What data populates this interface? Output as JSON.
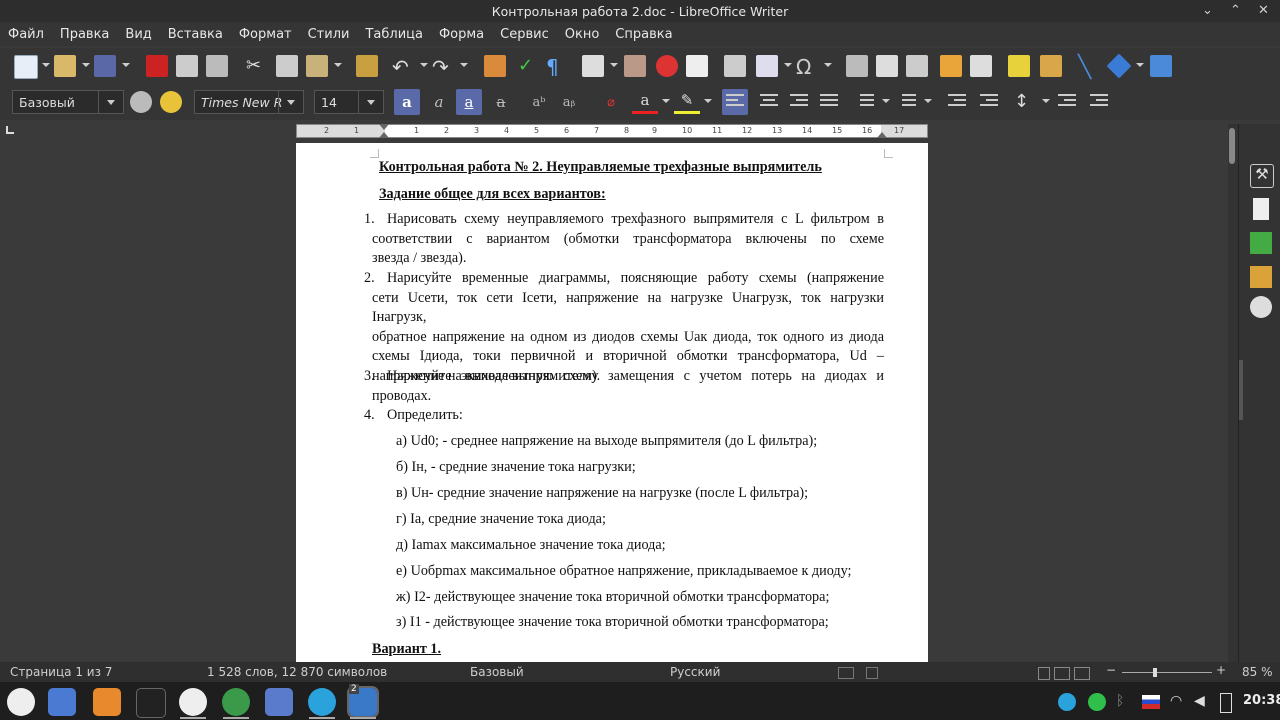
{
  "window": {
    "title": "Контрольная работа 2.doc - LibreOffice Writer"
  },
  "menu": {
    "items": [
      "Файл",
      "Правка",
      "Вид",
      "Вставка",
      "Формат",
      "Стили",
      "Таблица",
      "Форма",
      "Сервис",
      "Окно",
      "Справка"
    ]
  },
  "format_bar": {
    "paragraph_style": "Базовый",
    "font_name": "Times New R",
    "font_size": "14"
  },
  "ruler": {
    "ticks": [
      "2",
      "1",
      "1",
      "2",
      "3",
      "4",
      "5",
      "6",
      "7",
      "8",
      "9",
      "10",
      "11",
      "12",
      "13",
      "14",
      "15",
      "16",
      "17"
    ]
  },
  "document": {
    "title": "Контрольная работа № 2. Неуправляемые трехфазные выпрямитель",
    "subtitle": "Задание общее для всех вариантов:",
    "items": [
      {
        "num": "1.",
        "lines": [
          "Нарисовать схему неуправляемого трехфазного выпрямителя с L фильтром в",
          "соответствии с вариантом (обмотки трансформатора включены по схеме",
          "звезда / звезда)."
        ]
      },
      {
        "num": "2.",
        "lines": [
          "Нарисуйте временные диаграммы, поясняющие работу схемы (напряжение",
          "сети Uсети, ток сети Iсети, напряжение на нагрузке Uнагрузк, ток нагрузки Iнагрузк,",
          "обратное напряжение на одном из диодов схемы Uак диода, ток одного из диода",
          "схемы Iдиода, токи первичной и вторичной обмотки трансформатора, Ud –",
          "напряжение на выходе выпрямителя)."
        ]
      },
      {
        "num": "3.",
        "lines": [
          "Нарисуйте эквивалентную схему замещения с учетом потерь на диодах и",
          "проводах."
        ]
      },
      {
        "num": "4.",
        "lines": [
          "Определить:"
        ]
      }
    ],
    "subitems": [
      "а) Ud0; - среднее напряжение на выходе выпрямителя (до L фильтра);",
      "б) Iн, - средние значение тока нагрузки;",
      "в) Uн- средние значение напряжение на нагрузке (после L фильтра);",
      "г) Iа, средние значение тока диода;",
      "д) Iamax максимальное значение тока диода;",
      "е) Uобрmax максимальное обратное напряжение, прикладываемое к диоду;",
      "ж) I2- действующее значение тока вторичной обмотки трансформатора;",
      "з) I1 - действующее значение тока вторичной обмотки трансформатора;"
    ],
    "variant_heading": "Вариант 1."
  },
  "status": {
    "page": "Страница 1 из 7",
    "words": "1 528 слов, 12 870 символов",
    "style": "Базовый",
    "language": "Русский",
    "zoom": "85 %",
    "zoom_fraction": 0.36
  },
  "taskbar": {
    "clock": "20:38",
    "badge": "2"
  },
  "colors": {
    "accent": "#5a6aa8",
    "chrome": "#353535",
    "taskbar": "#1e1e1e"
  }
}
